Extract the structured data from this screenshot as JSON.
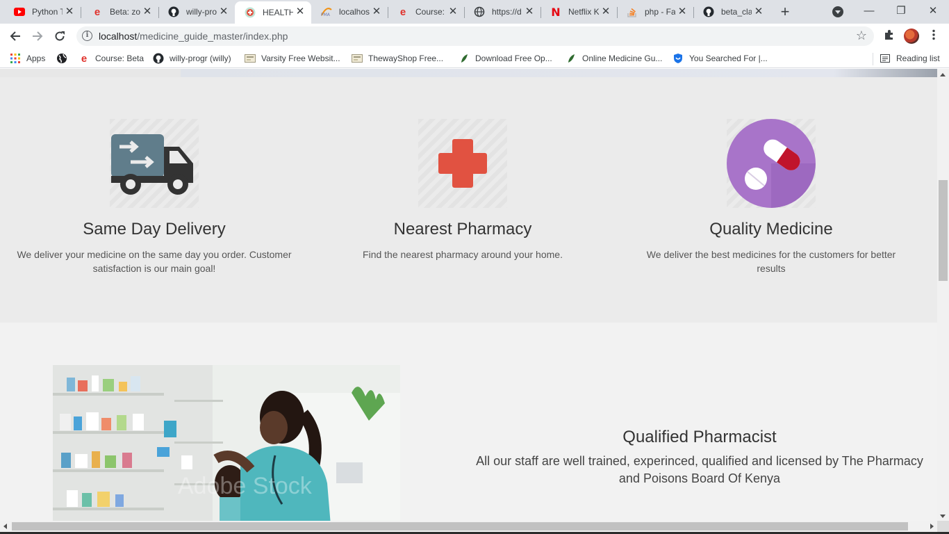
{
  "browser": {
    "tabs": [
      {
        "title": "Python T",
        "icon": "youtube-icon",
        "active": false
      },
      {
        "title": "Beta: zoo",
        "icon": "e-icon",
        "active": false
      },
      {
        "title": "willy-pro",
        "icon": "github-icon",
        "active": false
      },
      {
        "title": "HEALTHY",
        "icon": "health-icon",
        "active": true
      },
      {
        "title": "localhost",
        "icon": "phpmyadmin-icon",
        "active": false
      },
      {
        "title": "Course: B",
        "icon": "e-icon",
        "active": false
      },
      {
        "title": "https://d",
        "icon": "globe-icon",
        "active": false
      },
      {
        "title": "Netflix K",
        "icon": "netflix-icon",
        "active": false
      },
      {
        "title": "php - Fa",
        "icon": "stackoverflow-icon",
        "active": false
      },
      {
        "title": "beta_cla",
        "icon": "github-icon",
        "active": false
      }
    ],
    "close_glyph": "✕",
    "new_tab_glyph": "+",
    "window": {
      "minimize": "—",
      "restore": "❐",
      "close": "✕"
    },
    "url": {
      "host": "localhost",
      "path": "/medicine_guide_master/index.php"
    },
    "bookmarks": [
      {
        "label": "Apps",
        "icon": "apps-grid-icon"
      },
      {
        "label": "",
        "icon": "globe-icon"
      },
      {
        "label": "Course: Beta",
        "icon": "e-icon"
      },
      {
        "label": "willy-progr (willy)",
        "icon": "github-icon"
      },
      {
        "label": "Varsity Free Websit...",
        "icon": "template-icon"
      },
      {
        "label": "ThewayShop Free...",
        "icon": "template-icon"
      },
      {
        "label": "Download Free Op...",
        "icon": "leaf-icon"
      },
      {
        "label": "Online Medicine Gu...",
        "icon": "leaf-icon"
      },
      {
        "label": "You Searched For |...",
        "icon": "shield-icon"
      }
    ],
    "reading_list": "Reading list"
  },
  "features": [
    {
      "title": "Same Day Delivery",
      "desc": "We deliver your medicine on the same day you order. Customer satisfaction is our main goal!",
      "icon": "delivery-truck-icon"
    },
    {
      "title": "Nearest Pharmacy",
      "desc": "Find the nearest pharmacy around your home.",
      "icon": "red-cross-icon"
    },
    {
      "title": "Quality Medicine",
      "desc": "We deliver the best medicines for the customers for better results",
      "icon": "pills-icon"
    }
  ],
  "about": {
    "title": "Qualified Pharmacist",
    "text": "All our staff are well trained, experinced, qualified and licensed by The Pharmacy and Poisons Board Of Kenya",
    "photo_watermark": "Adobe Stock"
  },
  "colors": {
    "tabstrip": "#dee1e6",
    "features_bg": "#ebebeb",
    "about_bg": "#f2f2f2",
    "truck": "#607d8b",
    "cross": "#e15241",
    "pills_circle": "#a874c9"
  }
}
